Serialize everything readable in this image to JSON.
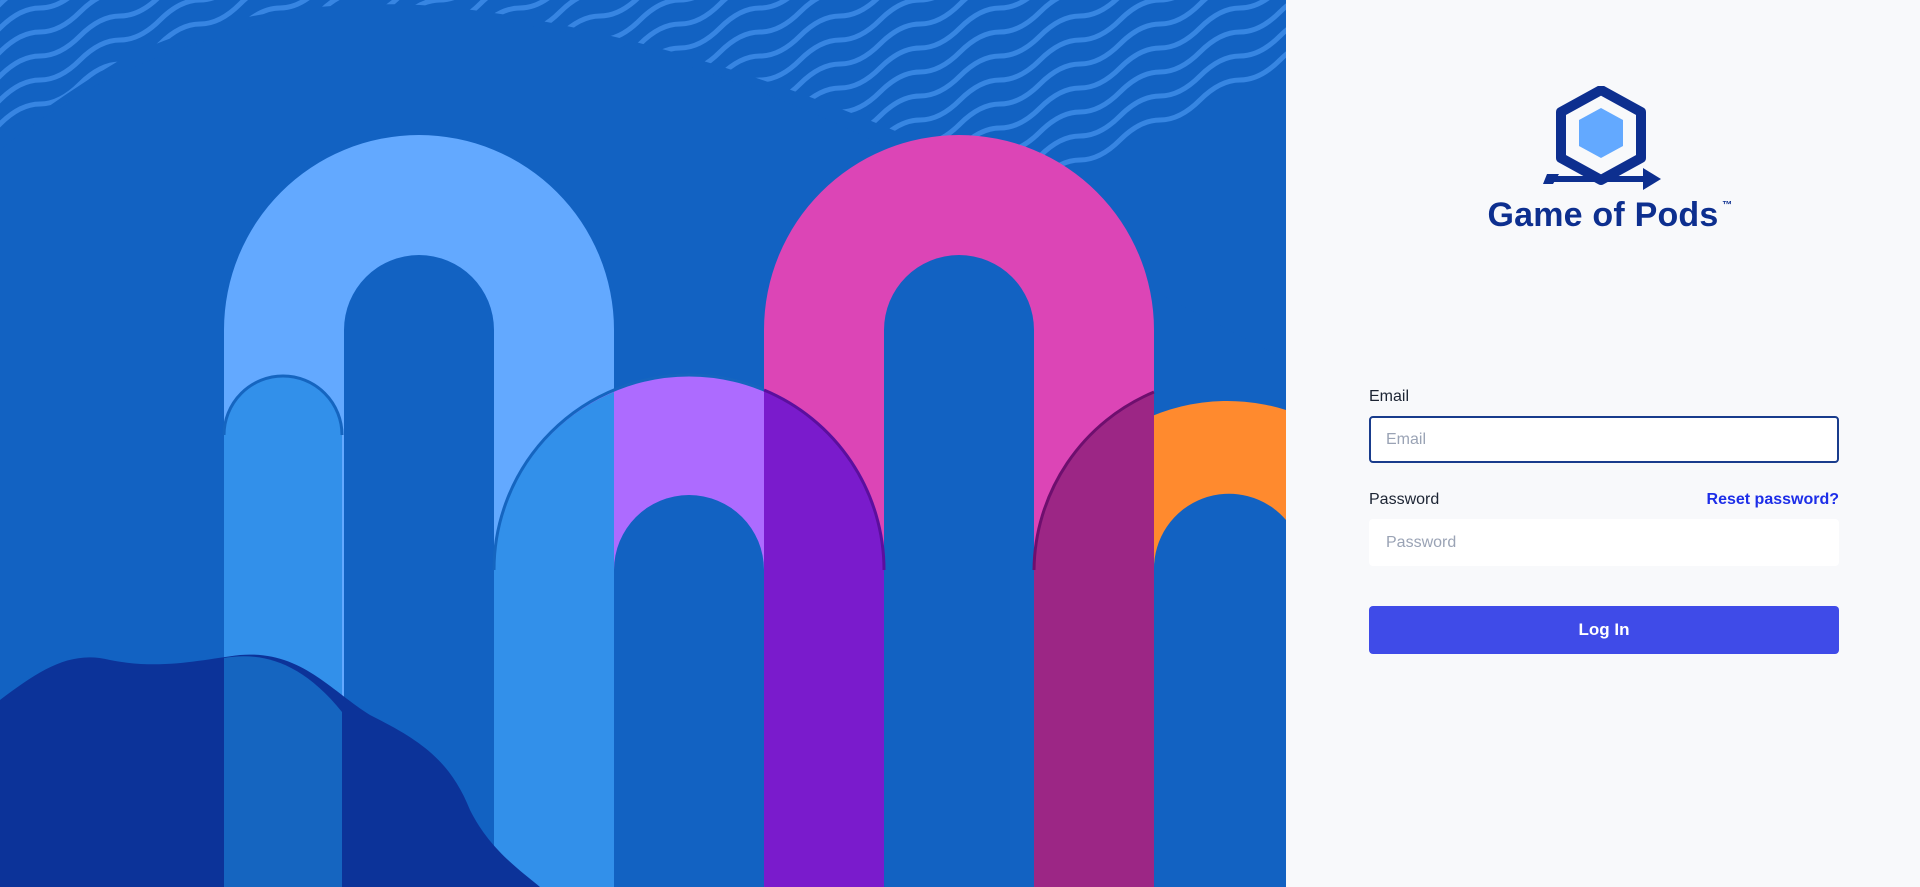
{
  "brand": {
    "name": "Game of Pods",
    "trademark": "™"
  },
  "login_form": {
    "email_label": "Email",
    "email_placeholder": "Email",
    "email_value": "",
    "password_label": "Password",
    "password_placeholder": "Password",
    "password_value": "",
    "reset_link": "Reset password?",
    "submit_label": "Log In"
  },
  "colors": {
    "hero_background": "#1262c2",
    "accent_button": "#3f4be8",
    "link": "#1d2ee8",
    "brand_text": "#0d2f8f"
  },
  "icons": {
    "logo": "hexagon-cube-logo-icon"
  }
}
